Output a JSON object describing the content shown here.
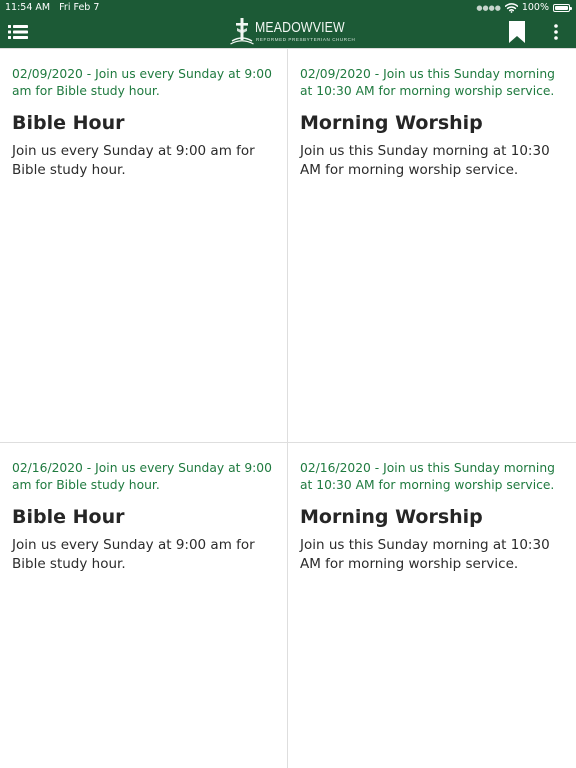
{
  "status_bar": {
    "time": "11:54 AM",
    "date": "Fri Feb 7",
    "battery_percent": "100%",
    "battery_level": 1.0
  },
  "header": {
    "logo_title": "MEADOWVIEW",
    "logo_subtitle": "REFORMED PRESBYTERIAN CHURCH",
    "icons": {
      "menu": "menu-list-icon",
      "bookmark": "bookmark-icon",
      "more": "more-vertical-icon"
    }
  },
  "colors": {
    "header_bg": "#1c5a36",
    "summary_text": "#1f7a3f",
    "title_text": "#262626",
    "divider": "#dedede"
  },
  "cards": [
    {
      "summary": "02/09/2020 - Join us every Sunday at 9:00 am for Bible study hour.",
      "title": "Bible Hour",
      "body": "Join us every Sunday at 9:00 am for Bible study hour."
    },
    {
      "summary": "02/09/2020 - Join us this Sunday morning at 10:30 AM for morning worship service.",
      "title": "Morning Worship",
      "body": "Join us this Sunday morning at 10:30 AM for morning worship service."
    },
    {
      "summary": "02/16/2020 - Join us every Sunday at 9:00 am for Bible study hour.",
      "title": "Bible Hour",
      "body": "Join us every Sunday at 9:00 am for Bible study hour."
    },
    {
      "summary": "02/16/2020 - Join us this Sunday morning at 10:30 AM for morning worship service.",
      "title": "Morning Worship",
      "body": "Join us this Sunday morning at 10:30 AM for morning worship service."
    }
  ]
}
